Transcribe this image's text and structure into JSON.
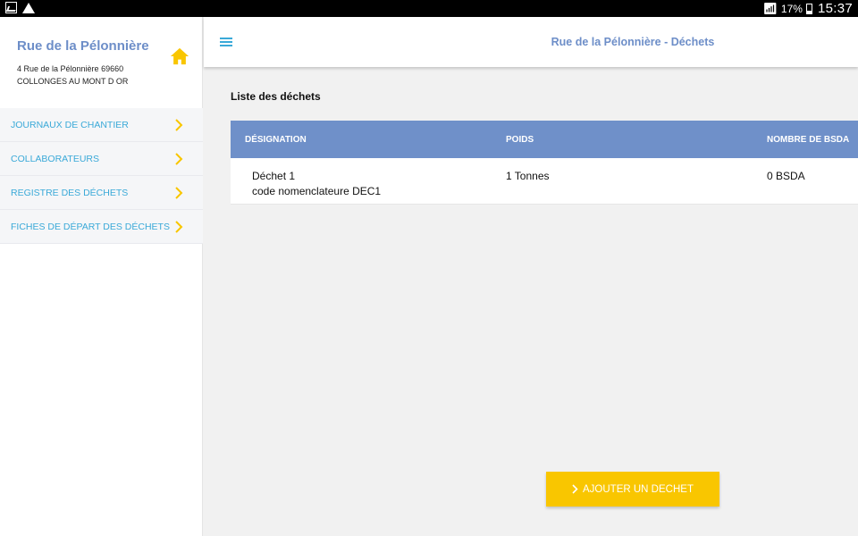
{
  "status_bar": {
    "battery": "17%",
    "time": "15:37",
    "icons": [
      "image-icon",
      "warning-icon",
      "wifi-icon",
      "battery-icon"
    ]
  },
  "sidebar": {
    "site_title": "Rue de la Pélonnière",
    "address_line1": "4 Rue de la Pélonnière 69660",
    "address_line2": "COLLONGES AU MONT D OR",
    "home_icon": "home-icon",
    "items": [
      {
        "label": "JOURNAUX DE CHANTIER"
      },
      {
        "label": "COLLABORATEURS"
      },
      {
        "label": "REGISTRE DES DÉCHETS"
      },
      {
        "label": "FICHES DE DÉPART DES DÉCHETS"
      }
    ]
  },
  "header": {
    "menu_icon": "hamburger-icon",
    "title": "Rue de la Pélonnière - Déchets"
  },
  "main": {
    "section_title": "Liste des déchets",
    "table": {
      "columns": [
        "DÉSIGNATION",
        "POIDS",
        "NOMBRE DE BSDA"
      ],
      "rows": [
        {
          "designation": "Déchet 1",
          "code": "code nomenclateure DEC1",
          "poids": "1 Tonnes",
          "bsda": "0 BSDA"
        }
      ]
    },
    "add_button_label": "AJOUTER UN DECHET"
  },
  "colors": {
    "accent_blue": "#6f90c9",
    "link_blue": "#3aa9d8",
    "accent_yellow": "#f9c600"
  }
}
